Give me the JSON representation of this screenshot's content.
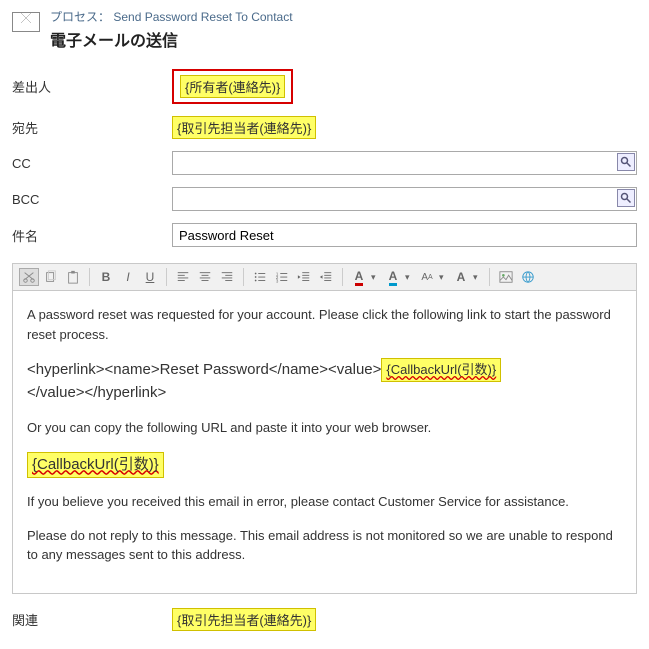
{
  "header": {
    "process_label_prefix": "プロセス：",
    "process_name": "Send Password Reset To Contact",
    "title": "電子メールの送信"
  },
  "labels": {
    "from": "差出人",
    "to": "宛先",
    "cc": "CC",
    "bcc": "BCC",
    "subject": "件名",
    "related": "関連"
  },
  "values": {
    "from": "{所有者(連絡先)}",
    "to": "{取引先担当者(連絡先)}",
    "cc": "",
    "bcc": "",
    "subject": "Password Reset",
    "related": "{取引先担当者(連絡先)}"
  },
  "body": {
    "p1": "A password reset was requested for your account. Please click the following link to start the password reset process.",
    "hyper_pre": "<hyperlink><name>Reset Password</name><value>",
    "callback1": "{CallbackUrl(引数)}",
    "hyper_post": "</value></hyperlink>",
    "p2": "Or you can copy the following URL and paste it into your web browser.",
    "callback2": "{CallbackUrl(引数)}",
    "p3": "If you believe you received this email in error, please contact Customer Service for assistance.",
    "p4": "Please do not reply to this message. This email address is not monitored so we are unable to respond to any messages sent to this address."
  }
}
